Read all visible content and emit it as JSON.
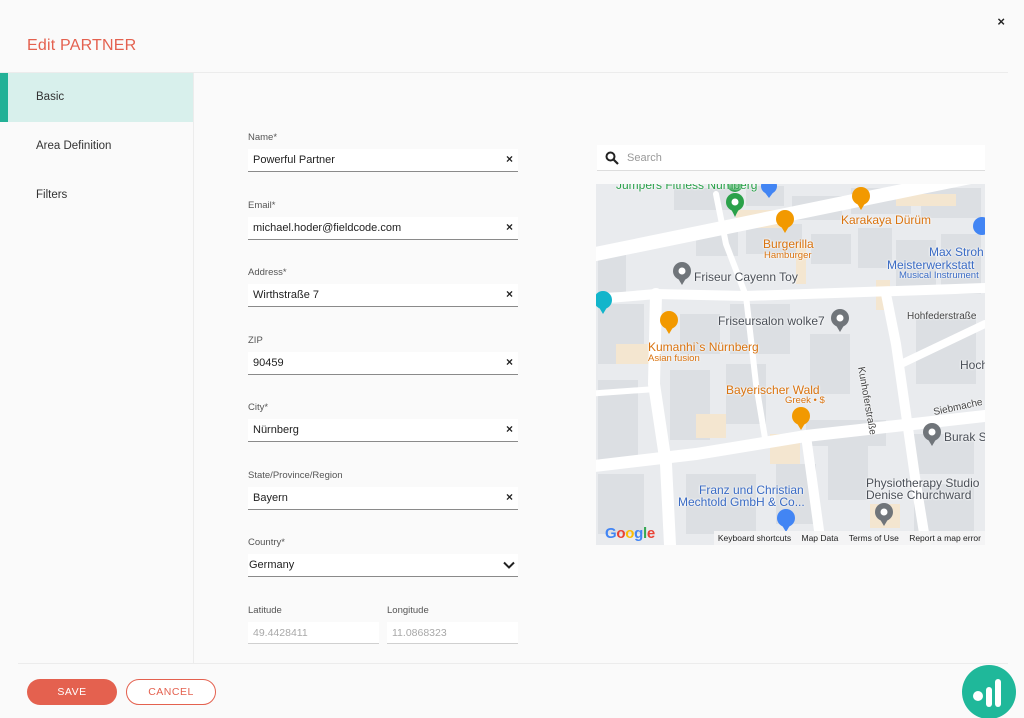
{
  "header": {
    "title": "Edit PARTNER",
    "close_label": "×"
  },
  "sidebar": {
    "items": [
      {
        "label": "Basic",
        "active": true
      },
      {
        "label": "Area Definition",
        "active": false
      },
      {
        "label": "Filters",
        "active": false
      }
    ]
  },
  "form": {
    "name": {
      "label": "Name*",
      "value": "Powerful Partner"
    },
    "email": {
      "label": "Email*",
      "value": "michael.hoder@fieldcode.com"
    },
    "address": {
      "label": "Address*",
      "value": "Wirthstraße 7"
    },
    "zip": {
      "label": "ZIP",
      "value": "90459"
    },
    "city": {
      "label": "City*",
      "value": "Nürnberg"
    },
    "state": {
      "label": "State/Province/Region",
      "value": "Bayern"
    },
    "country": {
      "label": "Country*",
      "value": "Germany"
    },
    "latitude": {
      "label": "Latitude",
      "value": "49.4428411"
    },
    "longitude": {
      "label": "Longitude",
      "value": "11.0868323"
    },
    "clear_icon": "×"
  },
  "map": {
    "search_placeholder": "Search",
    "labels": {
      "jumpers": "Jumpers Fitness Nürnberg",
      "karakaya": "Karakaya Dürüm",
      "burgerilla": "Burgerilla",
      "burgerilla_sub": "Hamburger",
      "max_stroh": "Max Stroh",
      "meisterwerkstatt": "Meisterwerkstatt",
      "musical": "Musical Instrument",
      "friseur_cayenn": "Friseur Cayenn Toy",
      "friseursalon": "Friseursalon wolke7",
      "hohfeder": "Hohfederstraße",
      "kumanhi": "Kumanhi`s Nürnberg",
      "kumanhi_sub": "Asian fusion",
      "kunhofer": "Kunhoferstraße",
      "hoch": "Hoch",
      "bayerischer": "Bayerischer Wald",
      "bayerischer_sub": "Greek • $",
      "siebmacher": "Siebmache",
      "burak": "Burak S",
      "franz1": "Franz und Christian",
      "franz2": "Mechtold GmbH & Co...",
      "physio1": "Physiotherapy Studio",
      "physio2": "Denise Churchward"
    },
    "google_logo": "Google",
    "footer_links": [
      "Keyboard shortcuts",
      "Map Data",
      "Terms of Use",
      "Report a map error"
    ]
  },
  "footer": {
    "save_label": "SAVE",
    "cancel_label": "CANCEL"
  },
  "colors": {
    "accent": "#e4614f",
    "brand_teal": "#23b197",
    "active_bg": "#d8f0ec"
  }
}
